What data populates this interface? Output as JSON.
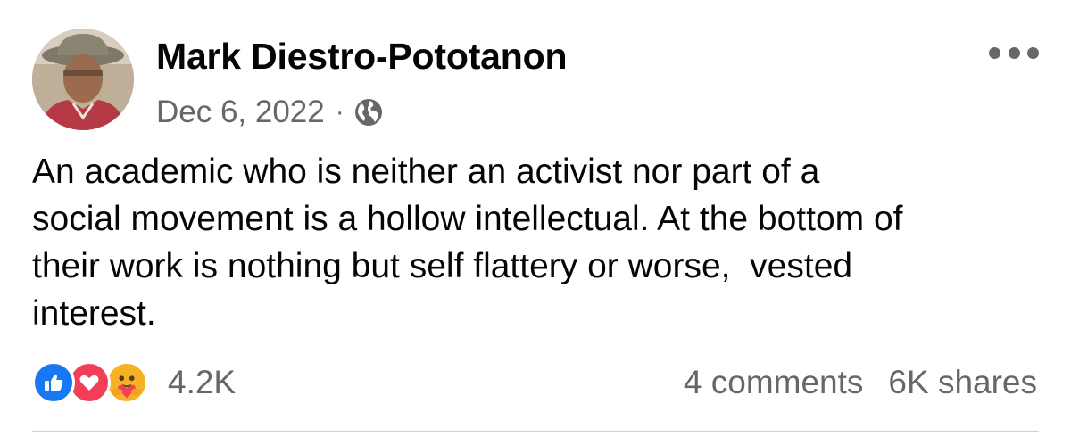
{
  "post": {
    "author": {
      "name": "Mark Diestro-Pototanon",
      "avatar_icon": "profile-photo"
    },
    "date": "Dec 6, 2022",
    "separator": "·",
    "privacy_icon": "globe-icon",
    "more_icon": "more-options-icon",
    "text": "An academic who is neither an activist nor part of a\nsocial movement is a hollow intellectual. At the bottom of\ntheir work is nothing but self flattery or worse,  vested\ninterest."
  },
  "engagement": {
    "reactions": [
      "like",
      "love",
      "care"
    ],
    "reaction_count": "4.2K",
    "comments": "4 comments",
    "shares": "6K shares"
  },
  "colors": {
    "text_primary": "#050505",
    "text_secondary": "#65676b",
    "like_blue": "#1877f2",
    "love_red": "#f33e58",
    "care_yellow": "#f7b125",
    "divider": "#ced0d4"
  }
}
